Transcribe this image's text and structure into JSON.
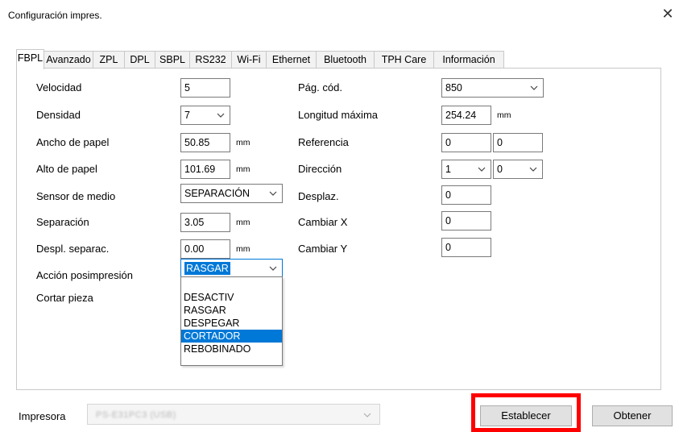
{
  "window": {
    "title": "Configuración impres.",
    "close_glyph": "✕"
  },
  "tabs": [
    "FBPL",
    "Avanzado",
    "ZPL",
    "DPL",
    "SBPL",
    "RS232",
    "Wi-Fi",
    "Ethernet",
    "Bluetooth",
    "TPH Care",
    "Información"
  ],
  "active_tab": "FBPL",
  "left": {
    "velocidad": {
      "label": "Velocidad",
      "value": "5"
    },
    "densidad": {
      "label": "Densidad",
      "value": "7"
    },
    "ancho": {
      "label": "Ancho de papel",
      "value": "50.85",
      "unit": "mm"
    },
    "alto": {
      "label": "Alto de papel",
      "value": "101.69",
      "unit": "mm"
    },
    "sensor": {
      "label": "Sensor de medio",
      "value": "SEPARACIÓN"
    },
    "separacion": {
      "label": "Separación",
      "value": "3.05",
      "unit": "mm"
    },
    "despl": {
      "label": "Despl. separac.",
      "value": "0.00",
      "unit": "mm"
    },
    "accion": {
      "label": "Acción posimpresión",
      "value": "RASGAR"
    },
    "cortar": {
      "label": "Cortar pieza"
    }
  },
  "dropdown": {
    "options": [
      "DESACTIV",
      "RASGAR",
      "DESPEGAR",
      "CORTADOR",
      "REBOBINADO"
    ],
    "highlighted": "CORTADOR"
  },
  "right": {
    "pagcod": {
      "label": "Pág. cód.",
      "value": "850"
    },
    "longitud": {
      "label": "Longitud máxima",
      "value": "254.24",
      "unit": "mm"
    },
    "referencia": {
      "label": "Referencia",
      "value_x": "0",
      "value_y": "0"
    },
    "direccion": {
      "label": "Dirección",
      "value_1": "1",
      "value_2": "0"
    },
    "desplaz": {
      "label": "Desplaz.",
      "value": "0"
    },
    "cambiarx": {
      "label": "Cambiar X",
      "value": "0"
    },
    "cambiary": {
      "label": "Cambiar Y",
      "value": "0"
    }
  },
  "footer": {
    "printer_label": "Impresora",
    "printer_value": "PS-E31PC3 (USB)",
    "set_button": "Establecer",
    "get_button": "Obtener"
  },
  "colors": {
    "highlight": "#ff0000",
    "selection": "#0078d7"
  }
}
